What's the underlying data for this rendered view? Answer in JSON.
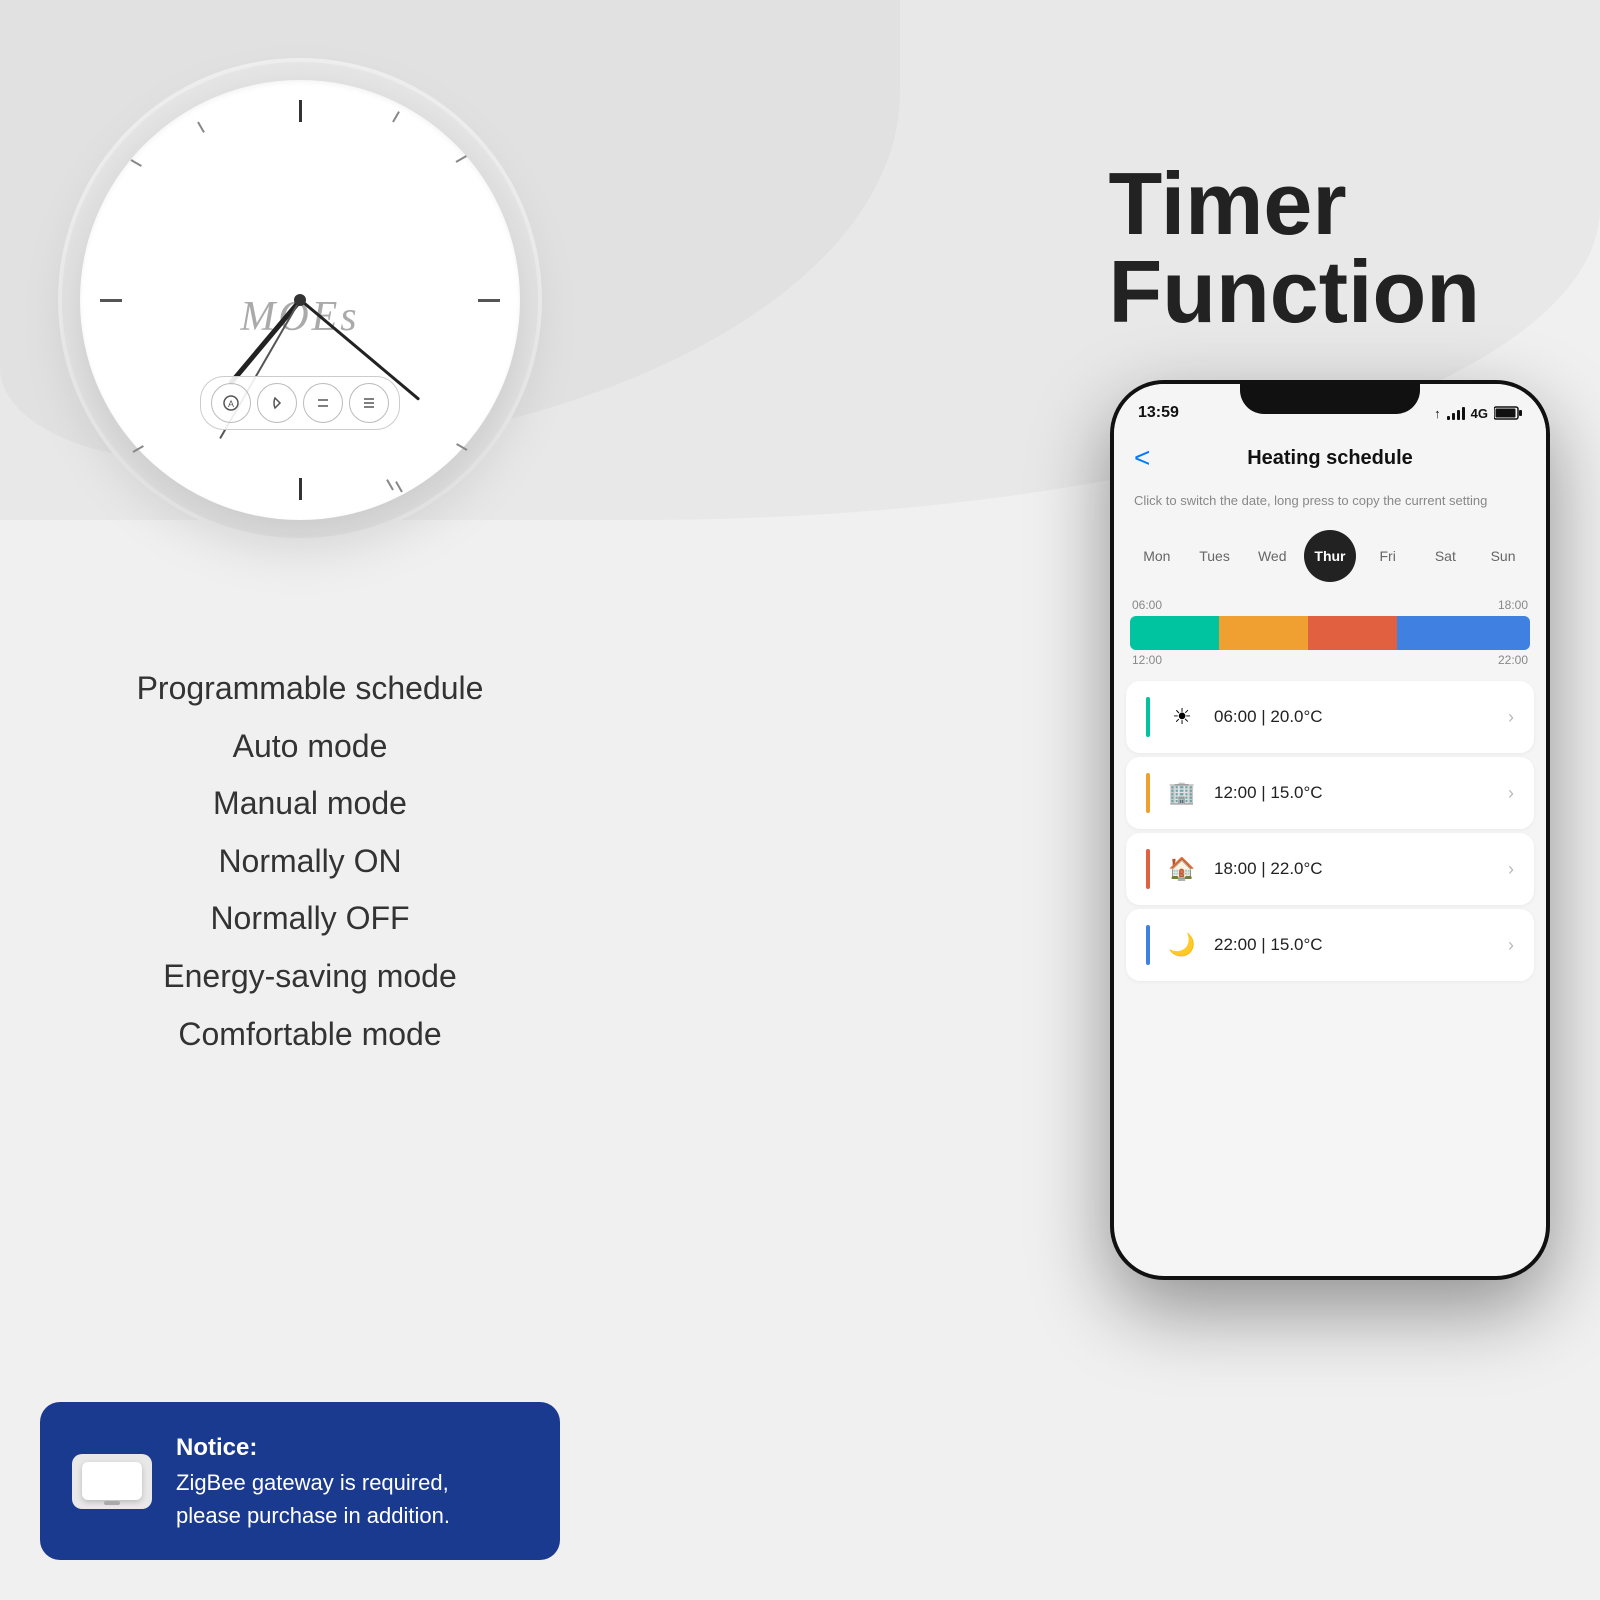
{
  "page": {
    "bg_color": "#f0f0f0"
  },
  "clock": {
    "brand": "MOEs",
    "controls": [
      "A",
      "☞",
      "//",
      "//"
    ]
  },
  "timer_title": {
    "line1": "Timer",
    "line2": "Function"
  },
  "features": [
    "Programmable schedule",
    "Auto mode",
    "Manual mode",
    "Normally ON",
    "Normally OFF",
    "Energy-saving mode",
    "Comfortable mode"
  ],
  "notice": {
    "title": "Notice:",
    "body": "ZigBee gateway is required,\nplease purchase in addition."
  },
  "phone": {
    "status": {
      "time": "13:59",
      "signal": "4G"
    },
    "header": {
      "back": "<",
      "title": "Heating schedule",
      "subtitle": "Click to switch the date, long press to copy the current setting"
    },
    "days": [
      {
        "label": "Mon",
        "active": false
      },
      {
        "label": "Tues",
        "active": false
      },
      {
        "label": "Wed",
        "active": false
      },
      {
        "label": "Thur",
        "active": true
      },
      {
        "label": "Fri",
        "active": false
      },
      {
        "label": "Sat",
        "active": false
      },
      {
        "label": "Sun",
        "active": false
      }
    ],
    "timebar": {
      "label_start": "06:00",
      "label_mid1": "18:00",
      "label_mid2": "12:00",
      "label_end": "22:00"
    },
    "schedule_items": [
      {
        "time": "06:00",
        "temp": "20.0°C",
        "color": "#00c4a0",
        "icon": "☀"
      },
      {
        "time": "12:00",
        "temp": "15.0°C",
        "color": "#f0a030",
        "icon": "🏢"
      },
      {
        "time": "18:00",
        "temp": "22.0°C",
        "color": "#e06040",
        "icon": "🏠"
      },
      {
        "time": "22:00",
        "temp": "15.0°C",
        "color": "#4080e0",
        "icon": "🌙"
      }
    ]
  }
}
